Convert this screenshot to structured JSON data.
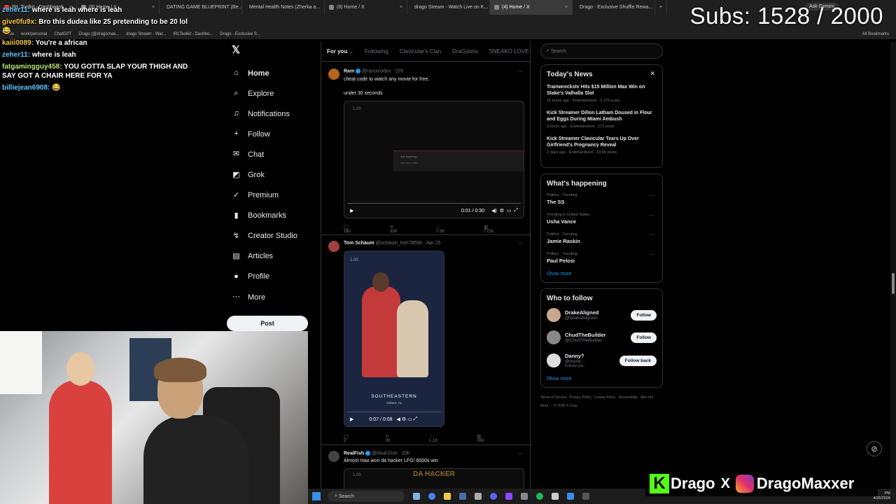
{
  "browser": {
    "tabs": [
      {
        "label": "IRL Toolkit - Dashboard",
        "color": "#e53935"
      },
      {
        "label": "(8) Home / X",
        "color": "#888"
      },
      {
        "label": "DATING GAME BLUEPRINT (Be...",
        "color": "#4285f4"
      },
      {
        "label": "Mental Health Notes (Zherka a...",
        "color": "#4285f4"
      },
      {
        "label": "(8) Home / X",
        "color": "#888"
      },
      {
        "label": "drago Stream - Watch Live on K...",
        "color": "#53fc18"
      },
      {
        "label": "(4) Home / X",
        "color": "#888",
        "active": true
      },
      {
        "label": "Drago - Exclusive Shuffle Rewa...",
        "color": "#7c4dff"
      }
    ],
    "ask_label": "Ask Gemini",
    "bookmarks": [
      "edu",
      "work/personal",
      "ChatGPT",
      "Drago (@dragomax...",
      "drago Stream - Wat...",
      "IRLToolkit - Dashbo...",
      "Drago - Exclusive S..."
    ],
    "all_bookmarks": "All Bookmarks"
  },
  "stream_overlay": {
    "subs_label": "Subs: 1528 / 2000",
    "social_names": [
      "Drago",
      "X",
      "DragoMaxxer"
    ],
    "kick_letter": "K"
  },
  "chat": [
    {
      "user": "zeher11:",
      "text": "where is leah where is leah",
      "color": "#5fc8ff"
    },
    {
      "user": "give0fu9x:",
      "text": "Bro this dudea like 25 pretending to be 20 lol 😂",
      "color": "#f5c542"
    },
    {
      "user": "kaiii0089:",
      "text": "You're a african",
      "color": "#f5c542"
    },
    {
      "user": "zeher11:",
      "text": "where is leah",
      "color": "#5fc8ff"
    },
    {
      "user": "fatgamingguy458:",
      "text": "YOU GOTTA SLAP YOUR THIGH AND SAY GOT A CHAIR HERE FOR YA",
      "color": "#b6e36a"
    },
    {
      "user": "billiejean6908:",
      "text": "😂",
      "color": "#5fc8ff"
    }
  ],
  "nav": {
    "logo": "𝕏",
    "items": [
      {
        "label": "Home",
        "icon": "⌂",
        "name": "home"
      },
      {
        "label": "Explore",
        "icon": "⌕",
        "name": "explore"
      },
      {
        "label": "Notifications",
        "icon": "♫",
        "name": "notifications"
      },
      {
        "label": "Follow",
        "icon": "+",
        "name": "follow"
      },
      {
        "label": "Chat",
        "icon": "✉",
        "name": "chat"
      },
      {
        "label": "Grok",
        "icon": "◩",
        "name": "grok"
      },
      {
        "label": "Premium",
        "icon": "✓",
        "name": "premium"
      },
      {
        "label": "Bookmarks",
        "icon": "▮",
        "name": "bookmarks"
      },
      {
        "label": "Creator Studio",
        "icon": "↯",
        "name": "creator-studio"
      },
      {
        "label": "Articles",
        "icon": "▤",
        "name": "articles"
      },
      {
        "label": "Profile",
        "icon": "●",
        "name": "profile"
      },
      {
        "label": "More",
        "icon": "⋯",
        "name": "more"
      }
    ],
    "post_label": "Post"
  },
  "feed": {
    "tabs": [
      "For you",
      "Following",
      "Clavicular's Clan",
      "DraGoons",
      "SNEAKO LOVE SP"
    ],
    "posts": [
      {
        "name": "Ram",
        "handle": "@ramxcodes · 20h",
        "text": "cheat code to watch any movie for free.",
        "subtext": "under 30 seconds",
        "video_time": "0:01 / 0:30",
        "video_badge": "1.00",
        "overlay_text": [
          "Ask anything...",
          "Add files or files"
        ],
        "stats": [
          "182",
          "336",
          "7.5K",
          "772K"
        ]
      },
      {
        "name": "Tom Schaum",
        "handle": "@schaum_tom78596 · Apr 25",
        "video_time": "0:07 / 0:08",
        "video_badge": "1.00",
        "video_caption": "SOUTHEASTERN",
        "video_subcaption": "Auburn, AL",
        "stats": [
          "2",
          "39",
          "1.1K",
          "35K"
        ]
      },
      {
        "name": "RealFish",
        "handle": "@Real.Fish · 20h",
        "text": "Almost max won da hacker LFG! 6000x win",
        "video_badge": "1.00",
        "video_caption": "DA HACKER"
      }
    ]
  },
  "sidebar": {
    "search_placeholder": "Search",
    "news_title": "Today's News",
    "news": [
      {
        "title": "Trainwreckstv Hits $15 Million Max Win on Stake's Valhalla Slot",
        "meta": "16 hours ago · Entertainment · 2,376 posts"
      },
      {
        "title": "Kick Streamer Dillon Latham Doused in Flour and Eggs During Miami Ambush",
        "meta": "8 hours ago · Entertainment · 173 posts"
      },
      {
        "title": "Kick Streamer Clavicular Tears Up Over Girlfriend's Pregnancy Reveal",
        "meta": "2 days ago · Entertainment · 19.6K posts"
      }
    ],
    "happening_title": "What's happening",
    "trends": [
      {
        "context": "Politics · Trending",
        "name": "The SS"
      },
      {
        "context": "Trending in United States",
        "name": "Usha Vance"
      },
      {
        "context": "Politics · Trending",
        "name": "Jamie Raskin"
      },
      {
        "context": "Politics · Trending",
        "name": "Paul Pelosi"
      }
    ],
    "show_more": "Show more",
    "who_title": "Who to follow",
    "who": [
      {
        "name": "DrakeAligned",
        "handle": "@DrakeAligned",
        "button": "Follow"
      },
      {
        "name": "ChudTheBuilder",
        "handle": "@ChudTheBuilder",
        "button": "Follow"
      },
      {
        "name": "Danny?",
        "handle": "@mone...",
        "badge": "Follows you",
        "button": "Follow back"
      }
    ],
    "footer": "Terms of Service · Privacy Policy · Cookie Policy · Accessibility · Ads info · More ··· © 2026 X Corp."
  },
  "taskbar": {
    "search_label": "Search",
    "time": "PM",
    "date": "4/26/2026"
  }
}
